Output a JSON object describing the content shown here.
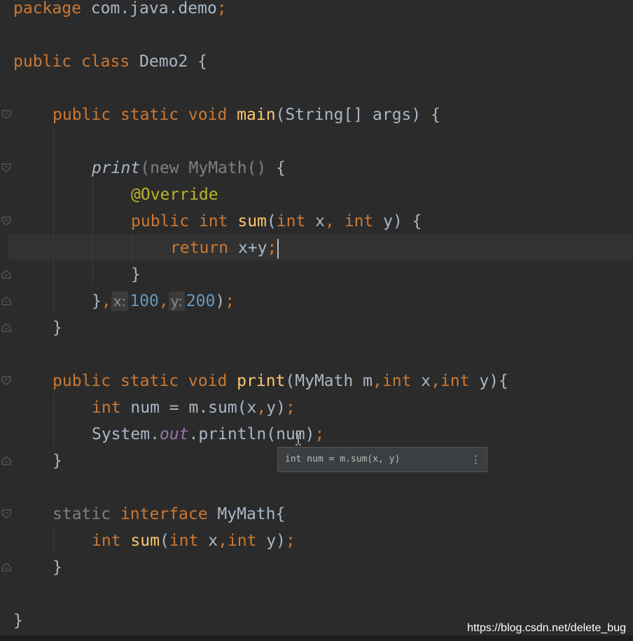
{
  "code": {
    "l1": {
      "kw": "package",
      "rest": " com.java.demo",
      "semi": ";"
    },
    "l2": {
      "kw1": "public",
      "kw2": "class",
      "rest": " Demo2 {"
    },
    "l3": {
      "kw1": "public",
      "kw2": "static",
      "kw3": "void",
      "fn": "main",
      "rest": "(String[] args) {"
    },
    "l4": {
      "fn": "print",
      "paren": "(",
      "gray": "new MyMath()",
      "rest": " {"
    },
    "l5": {
      "annotation": "@Override"
    },
    "l6": {
      "kw1": "public",
      "kw2": "int",
      "fn": "sum",
      "p1": "(",
      "kw3": "int",
      "p2": " x",
      "comma": ",",
      "kw4": "int",
      "p3": " y) {"
    },
    "l7": {
      "kw": "return",
      "rest": " x+y",
      "semi": ";"
    },
    "l8": {
      "text": "}"
    },
    "l9": {
      "brace": "}",
      "comma1": ",",
      "hint_x": "x:",
      "val_x": "100",
      "comma2": ",",
      "hint_y": "y:",
      "val_y": "200",
      "close": ")",
      "semi": ";"
    },
    "l10": {
      "text": "}"
    },
    "l11": {
      "kw1": "public",
      "kw2": "static",
      "kw3": "void",
      "fn": "print",
      "p1": "(MyMath m",
      "c1": ",",
      "kw4": "int",
      "p2": " x",
      "c2": ",",
      "kw5": "int",
      "p3": " y){"
    },
    "l12": {
      "kw": "int",
      "p1": " num = m.sum(x",
      "c": ",",
      "p2": "y)",
      "semi": ";"
    },
    "l13": {
      "p1": "System.",
      "field": "out",
      "p2": ".println(num)",
      "semi": ";"
    },
    "l14": {
      "text": "}"
    },
    "l15": {
      "gray": "static",
      "kw": "interface",
      "rest": " MyMath{"
    },
    "l16": {
      "kw1": "int",
      "fn": "sum",
      "p1": "(",
      "kw2": "int",
      "p2": " x",
      "c": ",",
      "kw3": "int",
      "p3": " y)",
      "semi": ";"
    },
    "l17": {
      "text": "}"
    },
    "l18": {
      "text": "}"
    }
  },
  "tooltip": {
    "text": "int num = m.sum(x, y)",
    "menu_icon": "more-vertical-icon",
    "menu_glyph": "⋮"
  },
  "watermark": "https://blog.csdn.net/delete_bug",
  "colors": {
    "background": "#2b2b2b",
    "keyword": "#cc7832",
    "function": "#ffc66d",
    "annotation": "#bbb529",
    "number": "#6897bb",
    "text": "#a9b7c6",
    "field": "#9876aa"
  }
}
